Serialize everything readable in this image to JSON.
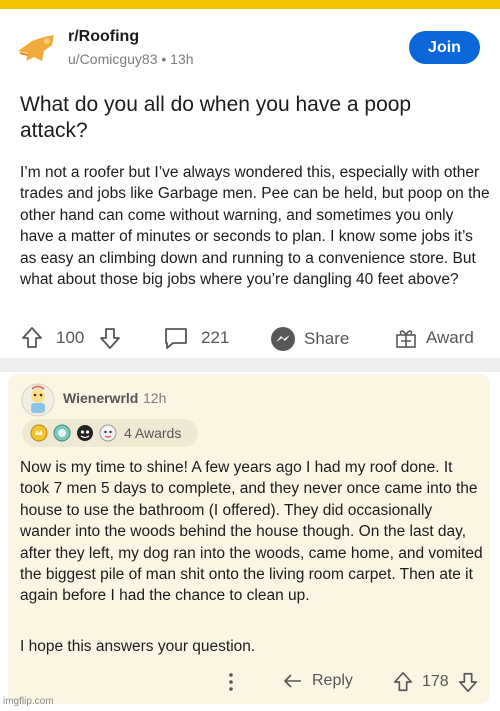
{
  "colors": {
    "top_strip": "#f5c400",
    "join_button": "#0a66d9",
    "comment_background": "#fbf6e4",
    "divider": "#eeeeee"
  },
  "post": {
    "subreddit": "r/Roofing",
    "meta": "u/Comicguy83 • 13h",
    "join_label": "Join",
    "title": "What do you all do when you have a poop attack?",
    "body": "I’m not a roofer but I’ve always wondered this, especially with other trades and jobs like Garbage men. Pee can be held, but poop on the other hand can come without warning, and sometimes you only have a matter of minutes or seconds to plan. I know some jobs it’s as easy an climbing down and running to a convenience store. But what about those big jobs where you’re dangling 40 feet above?",
    "upvotes": "100",
    "comments": "221",
    "share_label": "Share",
    "award_label": "Award"
  },
  "comment": {
    "username": "Wienerwrld",
    "time": "12h",
    "awards_label": "4 Awards",
    "body": "Now is my time to shine! A few years ago I had my roof done. It took 7 men 5 days to complete, and they never once came into the house to use the bathroom (I offered). They did occasionally wander into the woods behind the house though. On the last day, after they left, my dog ran into the woods, came home, and vomited the biggest pile of man shit onto the living room carpet. Then ate it again before I had the chance to clean up.",
    "answer": "I hope this answers your question.",
    "reply_label": "Reply",
    "score": "178"
  },
  "watermark": "imgflip.com"
}
